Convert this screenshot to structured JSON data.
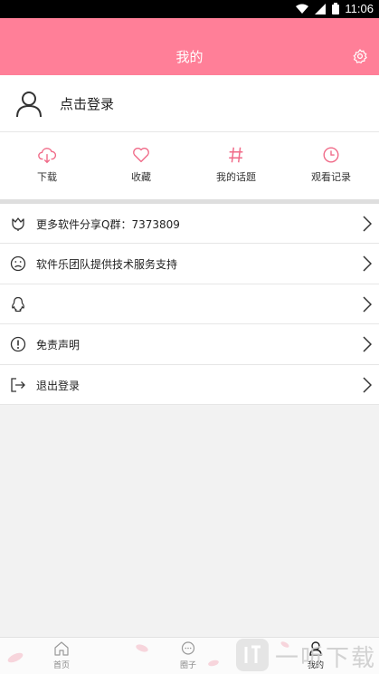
{
  "status_bar": {
    "time": "11:06"
  },
  "header": {
    "title": "我的"
  },
  "login": {
    "label": "点击登录"
  },
  "quick_actions": [
    {
      "label": "下载",
      "icon": "cloud-download-icon"
    },
    {
      "label": "收藏",
      "icon": "heart-icon"
    },
    {
      "label": "我的话题",
      "icon": "hashtag-icon"
    },
    {
      "label": "观看记录",
      "icon": "clock-icon"
    }
  ],
  "menu": [
    {
      "label": "更多软件分享Q群：7373809",
      "icon": "tulip-icon"
    },
    {
      "label": "软件乐团队提供技术服务支持",
      "icon": "sad-face-icon"
    },
    {
      "label": "",
      "icon": "qq-penguin-icon"
    },
    {
      "label": "免责声明",
      "icon": "exclamation-circle-icon"
    },
    {
      "label": "退出登录",
      "icon": "logout-icon"
    }
  ],
  "tabbar": [
    {
      "label": "首页",
      "icon": "home-icon",
      "active": false
    },
    {
      "label": "圈子",
      "icon": "chat-bubble-icon",
      "active": false
    },
    {
      "label": "我的",
      "icon": "profile-icon",
      "active": true
    }
  ],
  "watermark": {
    "text": "一听下载"
  },
  "colors": {
    "accent": "#ff7f98",
    "icon_accent": "#f06a88"
  }
}
